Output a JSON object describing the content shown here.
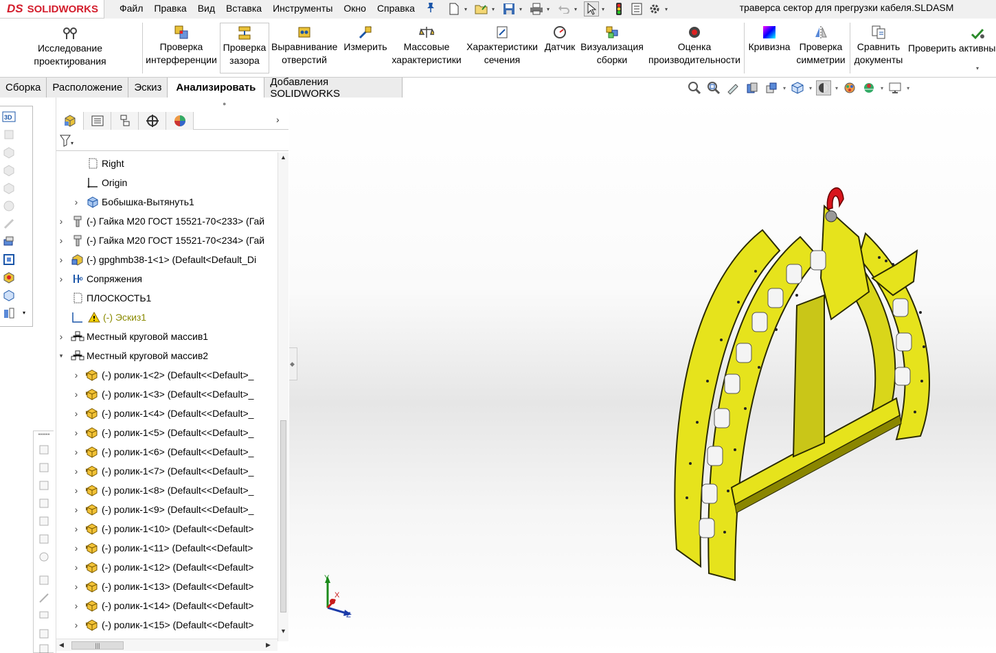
{
  "app": {
    "logo_ds": "DS",
    "logo_name": "SOLIDWORKS",
    "document_title": "траверса сектор для прегрузки кабеля.SLDASM"
  },
  "menu": [
    "Файл",
    "Правка",
    "Вид",
    "Вставка",
    "Инструменты",
    "Окно",
    "Справка"
  ],
  "quick_access": [
    "new-file-icon",
    "open-file-icon",
    "save-icon",
    "print-icon",
    "undo-icon",
    "select-icon",
    "rebuild-icon",
    "file-properties-icon",
    "options-icon"
  ],
  "ribbon": {
    "design_study": "Исследование проектирования",
    "interference_line1": "Проверка",
    "interference_line2": "интерференции",
    "clearance_line1": "Проверка",
    "clearance_line2": "зазора",
    "hole_align_line1": "Выравнивание",
    "hole_align_line2": "отверстий",
    "measure": "Измерить",
    "mass_line1": "Массовые",
    "mass_line2": "характеристики",
    "section_line1": "Характеристики",
    "section_line2": "сечения",
    "sensor": "Датчик",
    "viz_line1": "Визуализация",
    "viz_line2": "сборки",
    "perf_line1": "Оценка",
    "perf_line2": "производительности",
    "curvature": "Кривизна",
    "symmetry_line1": "Проверка",
    "symmetry_line2": "симметрии",
    "compare_line1": "Сравнить",
    "compare_line2": "документы",
    "check_active": "Проверить активны"
  },
  "tabs": [
    "Сборка",
    "Расположение",
    "Эскиз",
    "Анализировать",
    "Добавления SOLIDWORKS"
  ],
  "active_tab": "Анализировать",
  "tree": [
    {
      "label": "Right",
      "icon": "plane-icon"
    },
    {
      "label": "Origin",
      "icon": "origin-icon"
    },
    {
      "label": "Бобышка-Вытянуть1",
      "icon": "extrude-icon"
    },
    {
      "label": "(-) Гайка М20 ГОСТ 15521-70<233> (Гай",
      "icon": "bolt-icon"
    },
    {
      "label": "(-) Гайка М20 ГОСТ 15521-70<234> (Гай",
      "icon": "bolt-icon"
    },
    {
      "label": "(-) gpghmb38-1<1> (Default<Default_Di",
      "icon": "assembly-icon"
    },
    {
      "label": "Сопряжения",
      "icon": "mates-icon"
    },
    {
      "label": "ПЛОСКОСТЬ1",
      "icon": "plane-icon"
    },
    {
      "label": "(-) Эскиз1",
      "icon": "sketch-warning-icon"
    },
    {
      "label": "Местный круговой массив1",
      "icon": "pattern-icon"
    },
    {
      "label": "Местный круговой массив2",
      "icon": "pattern-icon"
    },
    {
      "label": "(-) ролик-1<2> (Default<<Default>_",
      "icon": "part-icon"
    },
    {
      "label": "(-) ролик-1<3> (Default<<Default>_",
      "icon": "part-icon"
    },
    {
      "label": "(-) ролик-1<4> (Default<<Default>_",
      "icon": "part-icon"
    },
    {
      "label": "(-) ролик-1<5> (Default<<Default>_",
      "icon": "part-icon"
    },
    {
      "label": "(-) ролик-1<6> (Default<<Default>_",
      "icon": "part-icon"
    },
    {
      "label": "(-) ролик-1<7> (Default<<Default>_",
      "icon": "part-icon"
    },
    {
      "label": "(-) ролик-1<8> (Default<<Default>_",
      "icon": "part-icon"
    },
    {
      "label": "(-) ролик-1<9> (Default<<Default>_",
      "icon": "part-icon"
    },
    {
      "label": "(-) ролик-1<10> (Default<<Default>",
      "icon": "part-icon"
    },
    {
      "label": "(-) ролик-1<11> (Default<<Default>",
      "icon": "part-icon"
    },
    {
      "label": "(-) ролик-1<12> (Default<<Default>",
      "icon": "part-icon"
    },
    {
      "label": "(-) ролик-1<13> (Default<<Default>",
      "icon": "part-icon"
    },
    {
      "label": "(-) ролик-1<14> (Default<<Default>",
      "icon": "part-icon"
    },
    {
      "label": "(-) ролик-1<15> (Default<<Default>",
      "icon": "part-icon"
    }
  ],
  "triad": {
    "x": "X",
    "y": "Y",
    "z": "Z"
  },
  "colors": {
    "model_yellow": "#e5e21c",
    "model_dark": "#8a8600",
    "hook_red": "#d8141c",
    "warning_text": "#8a8a00",
    "brand_red": "#d31d2c"
  }
}
